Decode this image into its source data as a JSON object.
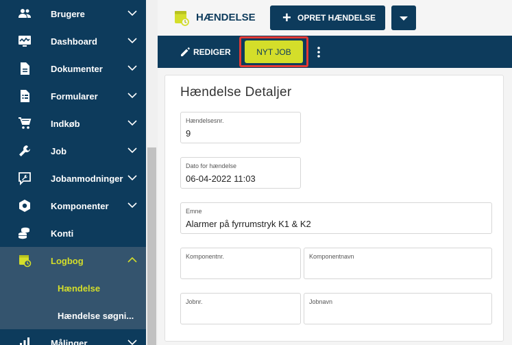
{
  "sidebar": {
    "items": [
      {
        "label": "Brugere",
        "icon": "users-icon"
      },
      {
        "label": "Dashboard",
        "icon": "dashboard-icon"
      },
      {
        "label": "Dokumenter",
        "icon": "document-icon"
      },
      {
        "label": "Formularer",
        "icon": "form-icon"
      },
      {
        "label": "Indkøb",
        "icon": "cart-icon"
      },
      {
        "label": "Job",
        "icon": "wrench-icon"
      },
      {
        "label": "Jobanmodninger",
        "icon": "request-icon"
      },
      {
        "label": "Komponenter",
        "icon": "component-icon"
      },
      {
        "label": "Konti",
        "icon": "coins-icon"
      },
      {
        "label": "Logbog",
        "icon": "logbook-icon"
      },
      {
        "label": "Målinger",
        "icon": "chart-icon"
      }
    ],
    "sub_items": [
      {
        "label": "Hændelse"
      },
      {
        "label": "Hændelse søgni..."
      }
    ]
  },
  "header": {
    "title": "HÆNDELSE",
    "create_label": "OPRET HÆNDELSE",
    "plus": "+"
  },
  "toolbar": {
    "edit_label": "REDIGER",
    "new_job_label": "NYT JOB"
  },
  "details": {
    "title": "Hændelse Detaljer",
    "fields": {
      "number": {
        "label": "Hændelsesnr.",
        "value": "9"
      },
      "date": {
        "label": "Dato for hændelse",
        "value": "06-04-2022 11:03"
      },
      "subject": {
        "label": "Emne",
        "value": "Alarmer på fyrrumstryk K1 & K2"
      },
      "component_no": {
        "label": "Komponentnr.",
        "value": ""
      },
      "component_name": {
        "label": "Komponentnavn",
        "value": ""
      },
      "job_no": {
        "label": "Jobnr.",
        "value": ""
      },
      "job_name": {
        "label": "Jobnavn",
        "value": ""
      }
    }
  },
  "colors": {
    "navy": "#0d3b5c",
    "accent": "#d4de2a",
    "highlight": "#e53935",
    "sidebar_active": "#34546e"
  }
}
